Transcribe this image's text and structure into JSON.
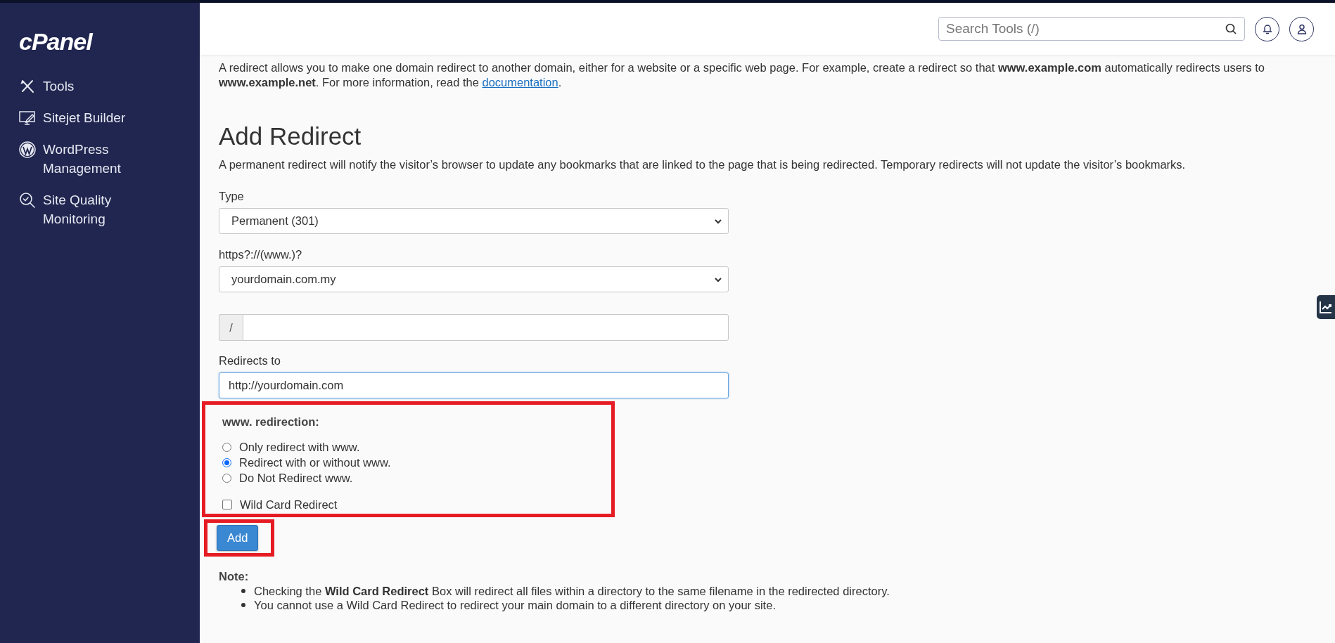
{
  "sidebar": {
    "logo": "cPanel",
    "items": [
      {
        "label": "Tools",
        "kind": "tools"
      },
      {
        "label": "Sitejet Builder",
        "kind": "sitejet"
      },
      {
        "label": "WordPress Management",
        "kind": "wordpress"
      },
      {
        "label": "Site Quality Monitoring",
        "kind": "quality"
      }
    ]
  },
  "header": {
    "search": {
      "placeholder": "Search Tools (/)"
    }
  },
  "intro": {
    "text": "A redirect allows you to make one domain redirect to another domain, either for a website or a specific web page. For example, create a redirect so that **www.example.com** automatically redirects users to **www.example.net**. For more information, read the ",
    "link": "documentation",
    "after": "."
  },
  "form": {
    "title": "Add Redirect",
    "description": "A permanent redirect will notify the visitor’s browser to update any bookmarks that are linked to the page that is being redirected. Temporary redirects will not update the visitor’s bookmarks.",
    "type": {
      "label": "Type",
      "value": "Permanent (301)"
    },
    "domain": {
      "label": "https?://(www.)?",
      "value": "yourdomain.com.my"
    },
    "path": {
      "prefix": "/"
    },
    "redirects_to": {
      "label": "Redirects to",
      "value": "http://yourdomain.com",
      "focused": true
    },
    "www_redirection": {
      "label": "www. redirection:",
      "highlighted": true,
      "options": [
        {
          "label": "Only redirect with www.",
          "selected": false
        },
        {
          "label": "Redirect with or without www.",
          "selected": true
        },
        {
          "label": "Do Not Redirect www.",
          "selected": false
        }
      ],
      "wildcard": {
        "label": "Wild Card Redirect",
        "checked": false
      }
    },
    "add_button": {
      "label": "Add",
      "highlighted": true
    }
  },
  "note": {
    "title": "Note:",
    "items": [
      "Checking the **Wild Card Redirect** Box will redirect all files within a directory to the same filename in the redirected directory.",
      "You cannot use a Wild Card Redirect to redirect your main domain to a different directory on your site."
    ]
  }
}
